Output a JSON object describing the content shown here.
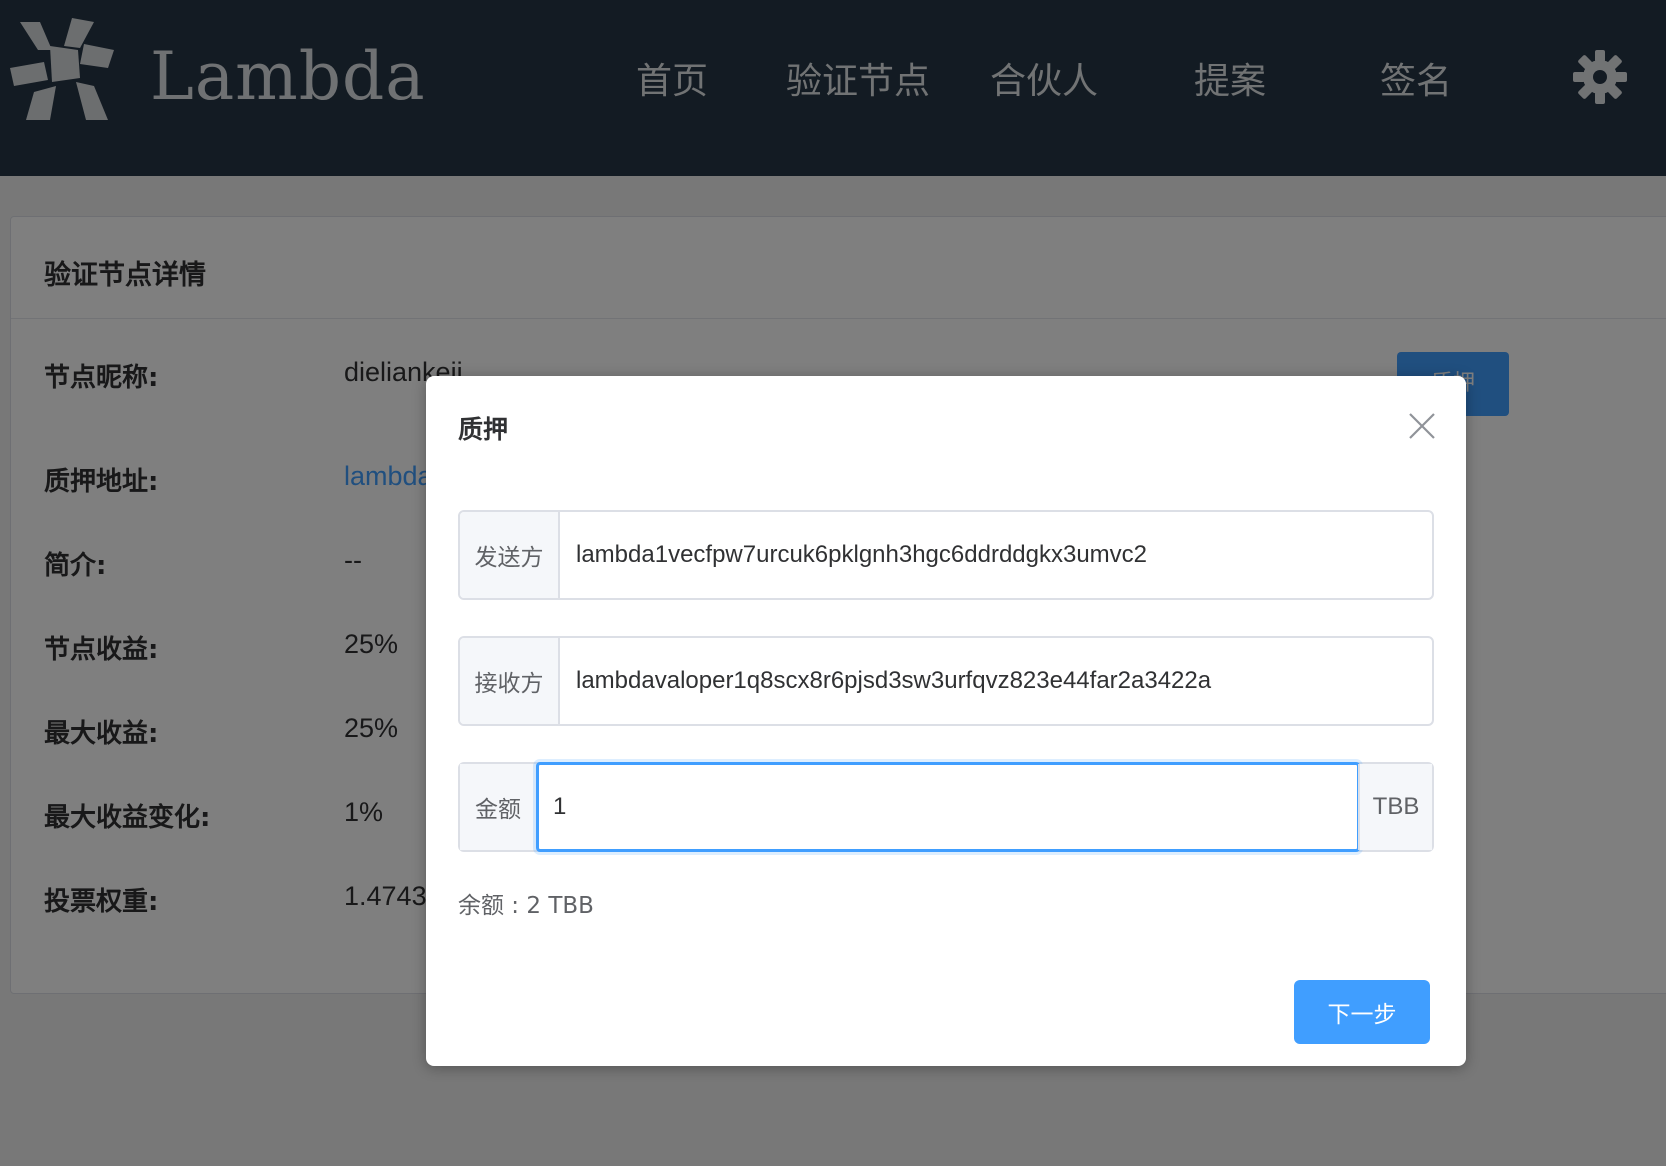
{
  "header": {
    "brand": "Lambda",
    "nav": [
      "首页",
      "验证节点",
      "合伙人",
      "提案",
      "签名"
    ]
  },
  "card": {
    "title": "验证节点详情",
    "rows": [
      {
        "label": "节点昵称:",
        "value": "dieliankeji"
      },
      {
        "label": "质押地址:",
        "value": "lambdavaloper1q8scx8r6pjsd3sw3urfqvz823e44far2a3422a"
      },
      {
        "label": "简介:",
        "value": "--"
      },
      {
        "label": "节点收益:",
        "value": "25%"
      },
      {
        "label": "最大收益:",
        "value": "25%"
      },
      {
        "label": "最大收益变化:",
        "value": "1%"
      },
      {
        "label": "投票权重:",
        "value": "1.4743"
      }
    ],
    "action_label": "质押"
  },
  "dialog": {
    "title": "质押",
    "sender_label": "发送方",
    "sender_value": "lambda1vecfpw7urcuk6pklgnh3hgc6ddrddgkx3umvc2",
    "receiver_label": "接收方",
    "receiver_value": "lambdavaloper1q8scx8r6pjsd3sw3urfqvz823e44far2a3422a",
    "amount_label": "金额",
    "amount_value": "1",
    "amount_unit": "TBB",
    "balance": "余额 : 2 TBB",
    "next_label": "下一步"
  },
  "colors": {
    "header_bg": "#263746",
    "primary": "#409eff"
  }
}
